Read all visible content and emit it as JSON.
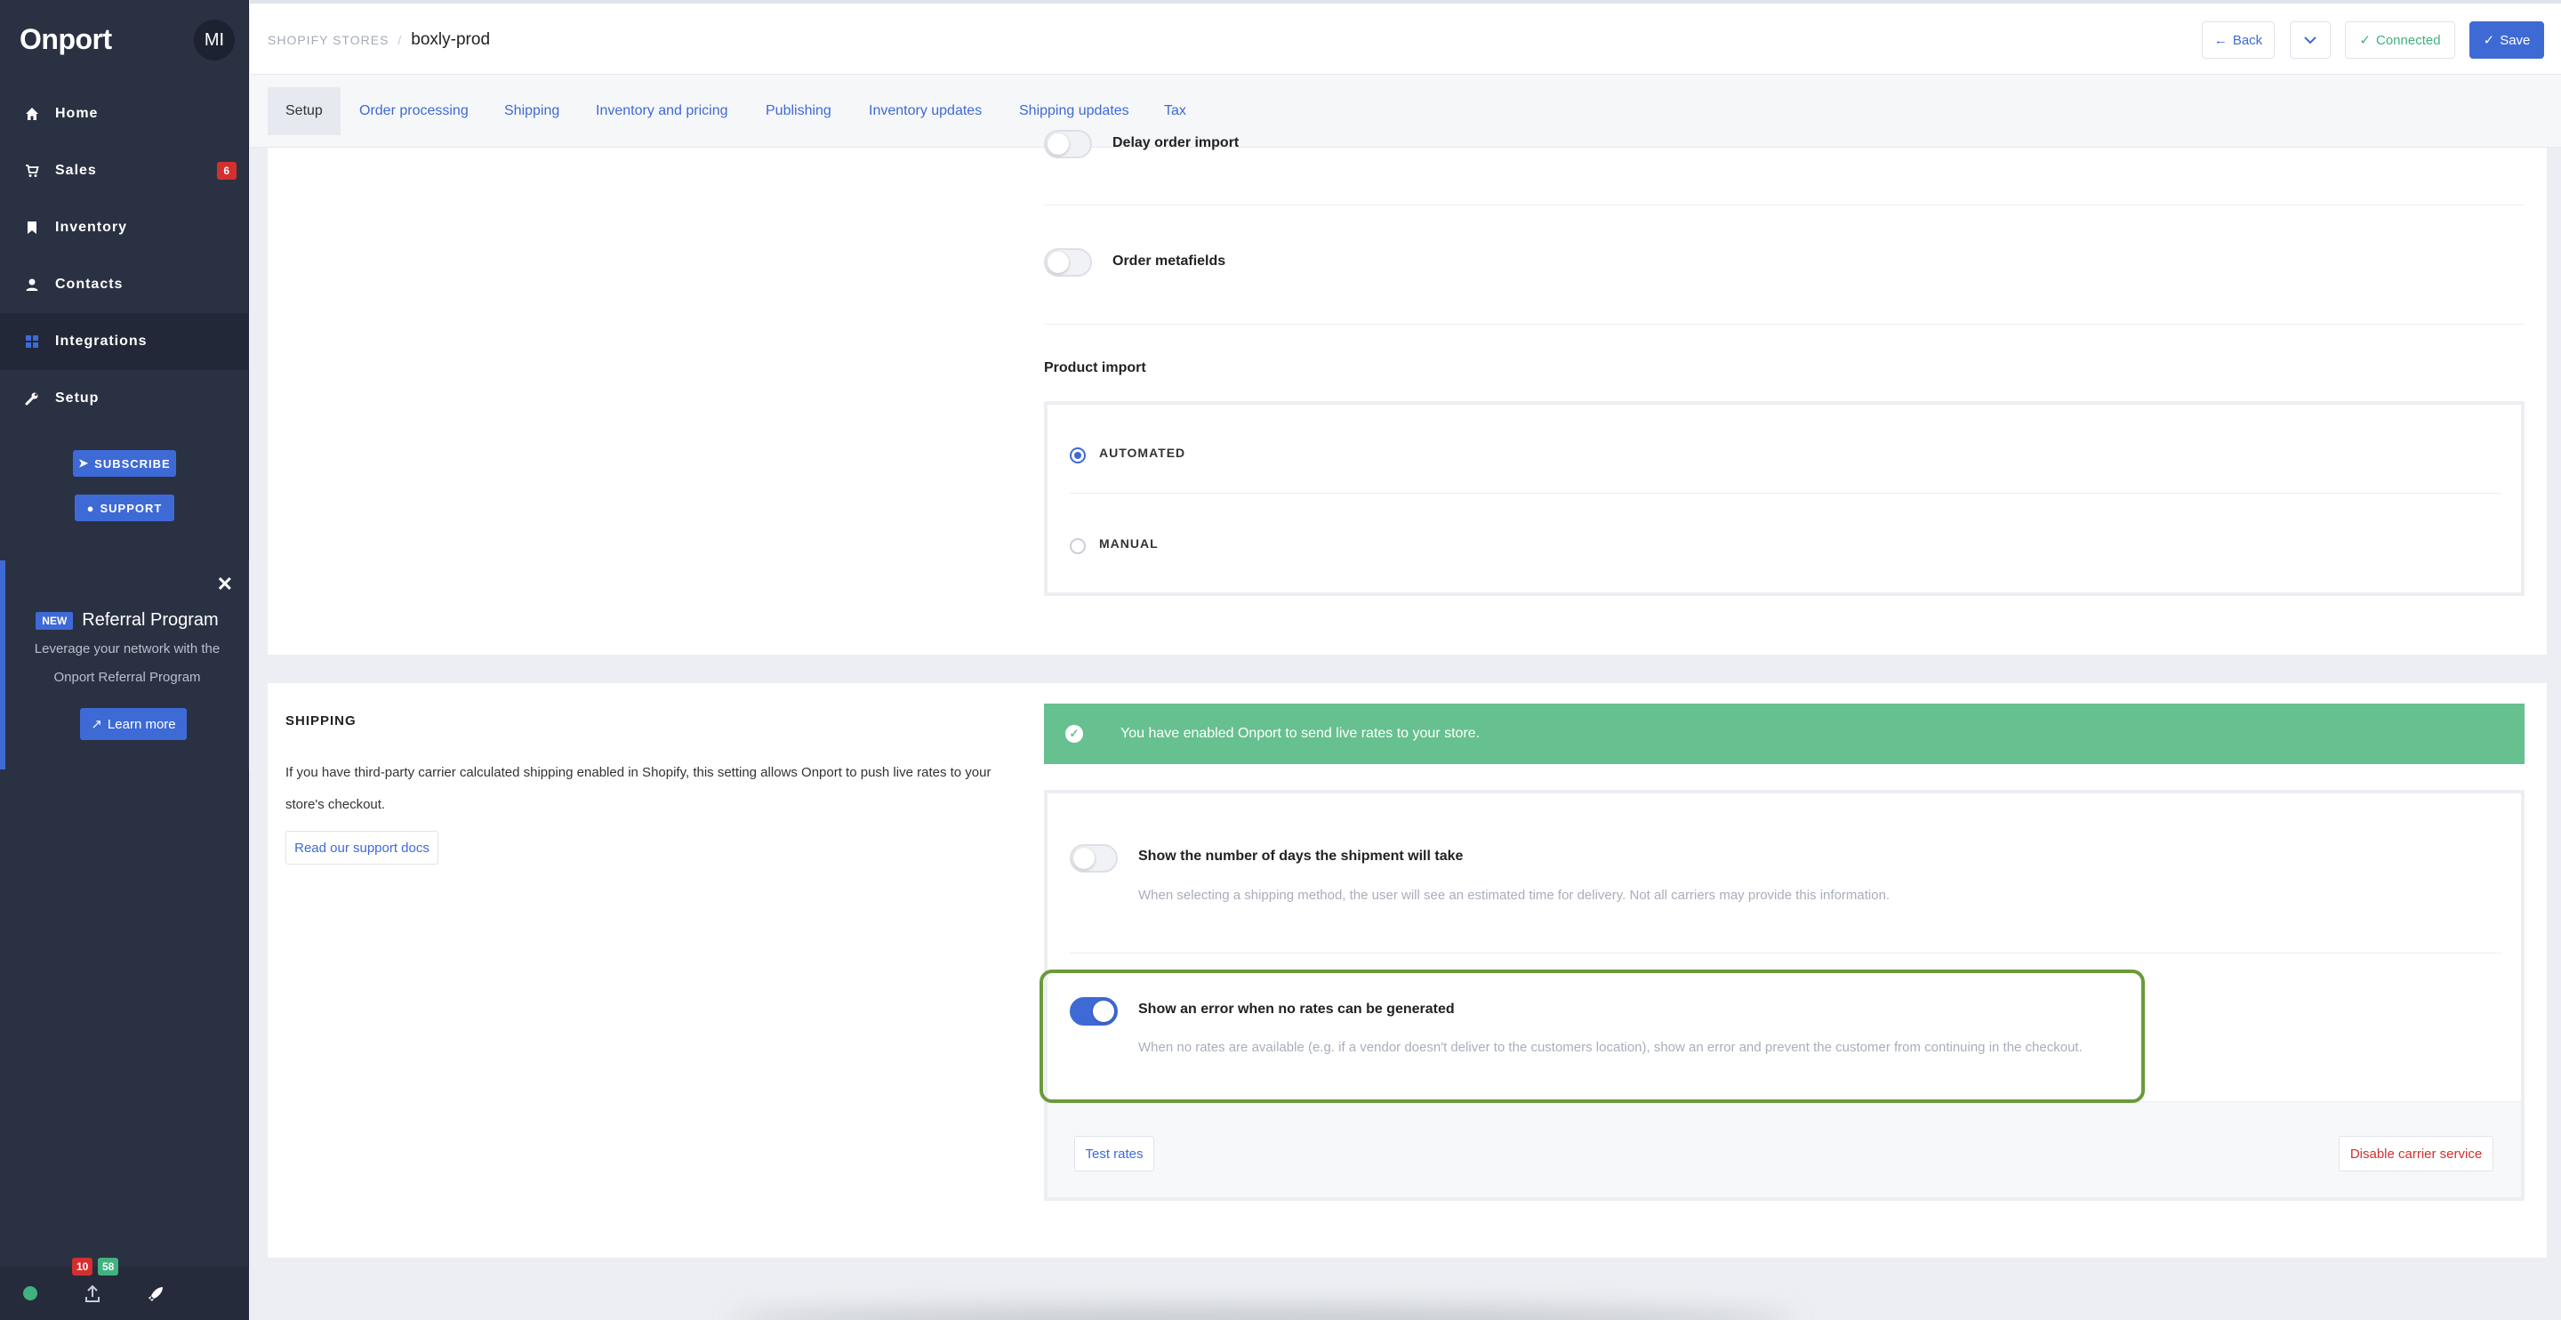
{
  "app": {
    "name": "Onport",
    "user_initials": "MI"
  },
  "sidebar": {
    "items": [
      {
        "label": "Home",
        "icon": "home-icon"
      },
      {
        "label": "Sales",
        "icon": "cart-icon",
        "badge": "6"
      },
      {
        "label": "Inventory",
        "icon": "bookmark-icon"
      },
      {
        "label": "Contacts",
        "icon": "person-icon"
      },
      {
        "label": "Integrations",
        "icon": "grid-icon",
        "active": true
      },
      {
        "label": "Setup",
        "icon": "wrench-icon"
      }
    ],
    "subscribe_label": "SUBSCRIBE",
    "support_label": "SUPPORT",
    "referral": {
      "badge": "NEW",
      "title": "Referral Program",
      "description": "Leverage your network with the Onport Referral Program",
      "button_label": "Learn more"
    },
    "footer": {
      "badge_red": "10",
      "badge_green": "58"
    }
  },
  "header": {
    "breadcrumb_parent": "SHOPIFY STORES",
    "breadcrumb_separator": "/",
    "breadcrumb_current": "boxly-prod",
    "back_label": "Back",
    "connected_label": "Connected",
    "save_label": "Save"
  },
  "tabs": [
    "Setup",
    "Order processing",
    "Shipping",
    "Inventory and pricing",
    "Publishing",
    "Inventory updates",
    "Shipping updates",
    "Tax"
  ],
  "orders": {
    "delay_import_label": "Delay order import",
    "metafields_label": "Order metafields"
  },
  "product_import": {
    "title": "Product import",
    "options": [
      "AUTOMATED",
      "MANUAL"
    ],
    "selected": "AUTOMATED"
  },
  "shipping": {
    "title": "SHIPPING",
    "description": "If you have third-party carrier calculated shipping enabled in Shopify, this setting allows Onport to push live rates to your store's checkout.",
    "docs_label": "Read our support docs",
    "success_message": "You have enabled Onport to send live rates to your store.",
    "days_option": {
      "label": "Show the number of days the shipment will take",
      "description": "When selecting a shipping method, the user will see an estimated time for delivery. Not all carriers may provide this information.",
      "enabled": false
    },
    "error_option": {
      "label": "Show an error when no rates can be generated",
      "description": "When no rates are available (e.g. if a vendor doesn't deliver to the customers location), show an error and prevent the customer from continuing in the checkout.",
      "enabled": true
    },
    "test_rates_label": "Test rates",
    "disable_label": "Disable carrier service"
  },
  "colors": {
    "accent": "#3e6ad6",
    "success": "#66c08f",
    "danger": "#d32f2f",
    "sidebar": "#2a3142",
    "highlight": "#6a9a3a"
  }
}
